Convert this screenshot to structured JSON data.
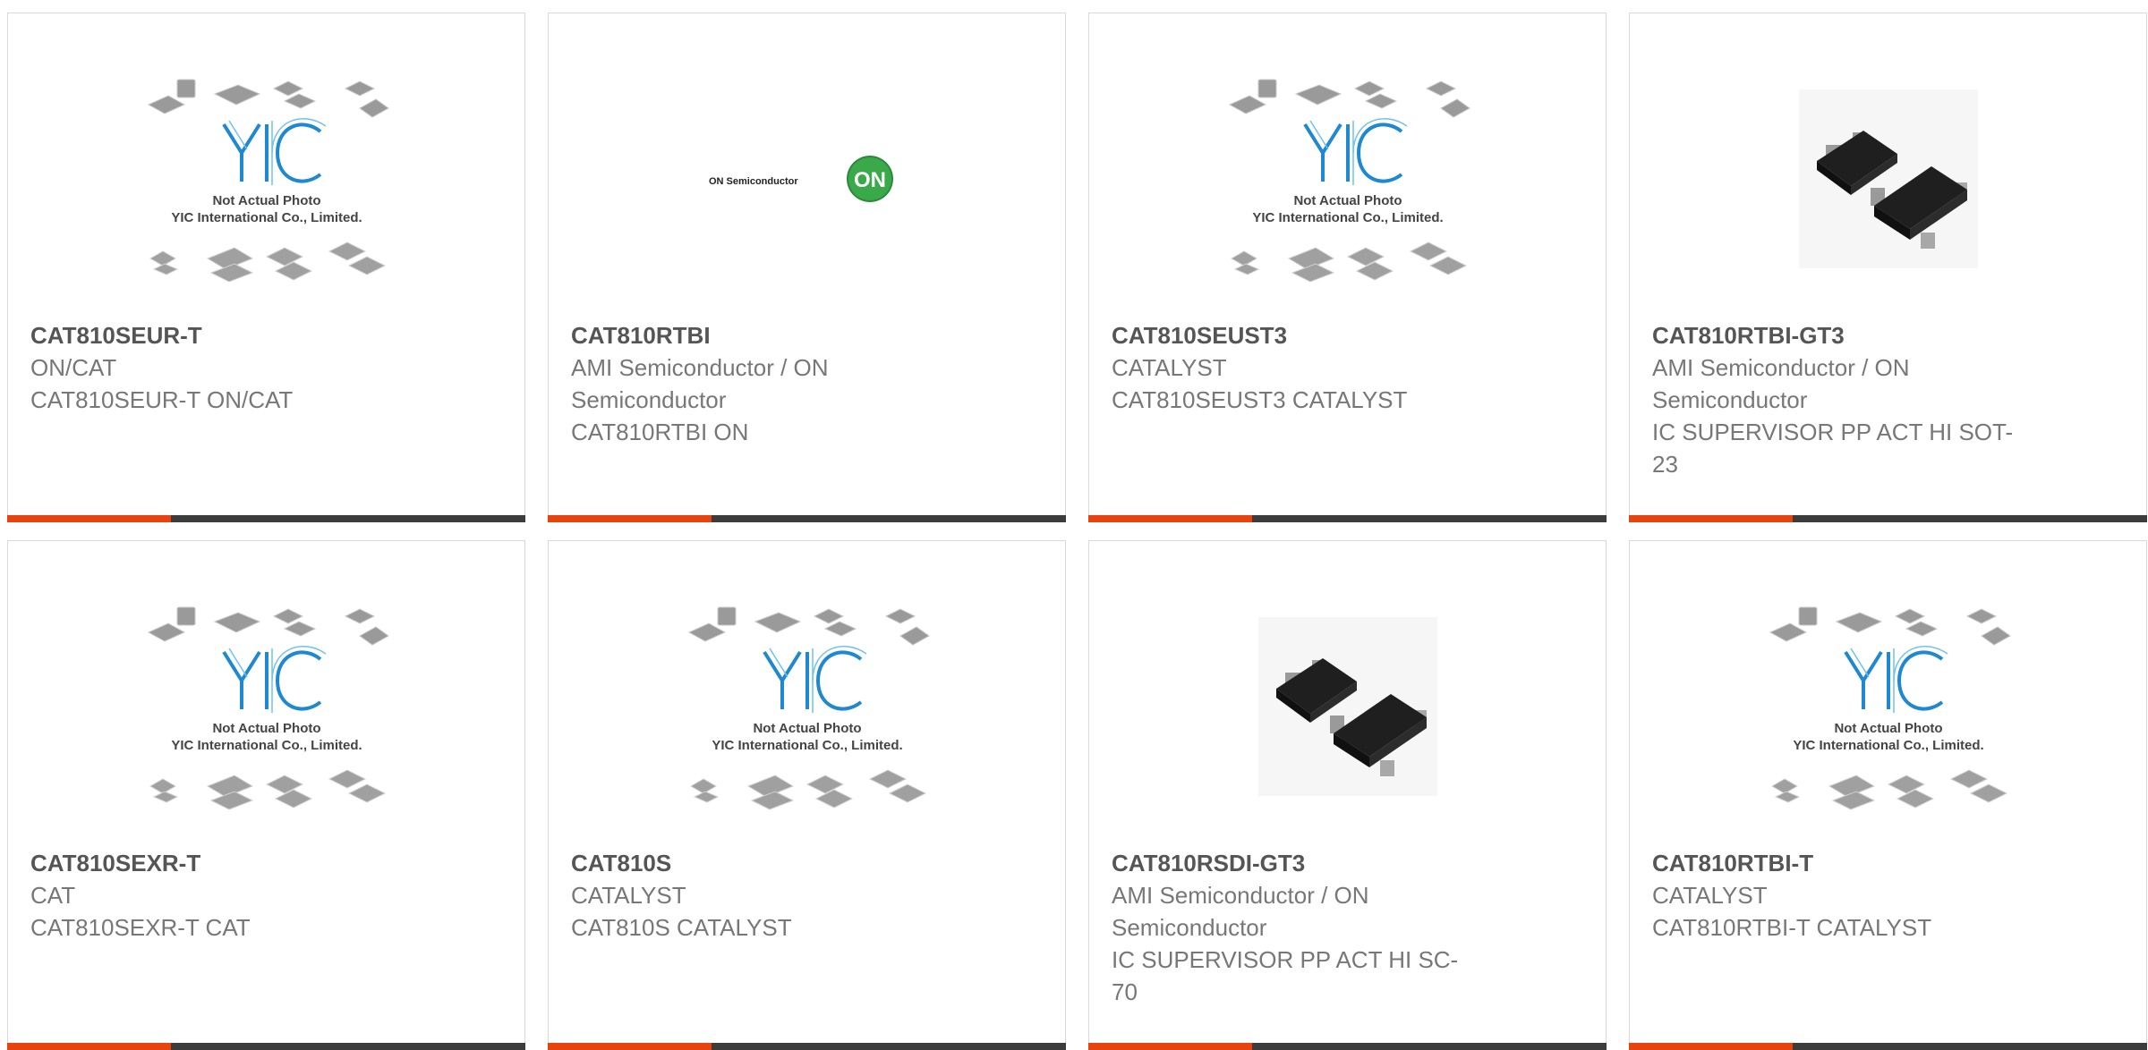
{
  "placeholder": {
    "brand": "YIC",
    "line1": "Not Actual Photo",
    "line2": "YIC International Co., Limited."
  },
  "on_logo": {
    "text": "ON Semiconductor",
    "mark": "ON"
  },
  "colors": {
    "accent": "#e8420d",
    "bar": "#3c3c3c",
    "border": "#d9d9d9",
    "yic_blue": "#1e88d0"
  },
  "products": [
    {
      "part": "CAT810SEUR-T",
      "manufacturer": "ON/CAT",
      "description": "CAT810SEUR-T ON/CAT",
      "image": "yic-placeholder"
    },
    {
      "part": "CAT810RTBI",
      "manufacturer": "AMI Semiconductor / ON Semiconductor",
      "description": "CAT810RTBI ON",
      "image": "on-semiconductor-logo"
    },
    {
      "part": "CAT810SEUST3",
      "manufacturer": "CATALYST",
      "description": "CAT810SEUST3 CATALYST",
      "image": "yic-placeholder"
    },
    {
      "part": "CAT810RTBI-GT3",
      "manufacturer": "AMI Semiconductor / ON Semiconductor",
      "description": "IC SUPERVISOR PP ACT HI SOT-23",
      "image": "sot-package-photo"
    },
    {
      "part": "CAT810SEXR-T",
      "manufacturer": "CAT",
      "description": "CAT810SEXR-T CAT",
      "image": "yic-placeholder"
    },
    {
      "part": "CAT810S",
      "manufacturer": "CATALYST",
      "description": "CAT810S CATALYST",
      "image": "yic-placeholder"
    },
    {
      "part": "CAT810RSDI-GT3",
      "manufacturer": "AMI Semiconductor / ON Semiconductor",
      "description": "IC SUPERVISOR PP ACT HI SC-70",
      "image": "sot-package-photo"
    },
    {
      "part": "CAT810RTBI-T",
      "manufacturer": "CATALYST",
      "description": "CAT810RTBI-T CATALYST",
      "image": "yic-placeholder"
    }
  ]
}
